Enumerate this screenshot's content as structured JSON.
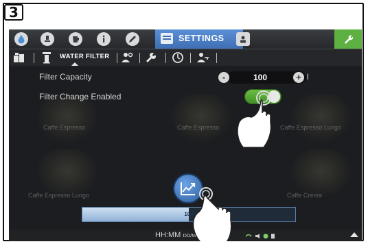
{
  "step": {
    "number": "3"
  },
  "topbar": {
    "icons": [
      "water-drop-icon",
      "coffee-cup-icon",
      "pitcher-icon",
      "info-icon",
      "edit-pencil-icon"
    ],
    "active_tab_label": "SETTINGS",
    "active_tab_icon": "settings-list-icon",
    "extra_icon": "user-badge-icon",
    "right_button_icon": "wrench-icon"
  },
  "subbar": {
    "active_label": "WATER FILTER",
    "icons": [
      "containers-icon",
      "filter-icon",
      "user-settings-icon",
      "wrench-icon",
      "clock-icon",
      "user-key-icon"
    ]
  },
  "settings": {
    "filter_capacity": {
      "label": "Filter Capacity",
      "value": "100",
      "minus": "-",
      "plus": "+",
      "unit": "l"
    },
    "filter_change_enabled": {
      "label": "Filter Change Enabled",
      "state": "on"
    }
  },
  "background_labels": [
    "Caffe Espresso",
    "Caffe Espresso",
    "Caffe Espresso Lungo",
    "Caffe Espresso Lungo",
    "Caffe Crema"
  ],
  "progress": {
    "value_text": "100",
    "fraction": 0.5
  },
  "status": {
    "time": "HH:MM",
    "date_format": "DD/MM/Y"
  },
  "colors": {
    "settings_tab": "#4a80c8",
    "wrench_button": "#5fb043",
    "toggle_on": "#5aad38",
    "progress_fill": "#b8d1ec"
  }
}
